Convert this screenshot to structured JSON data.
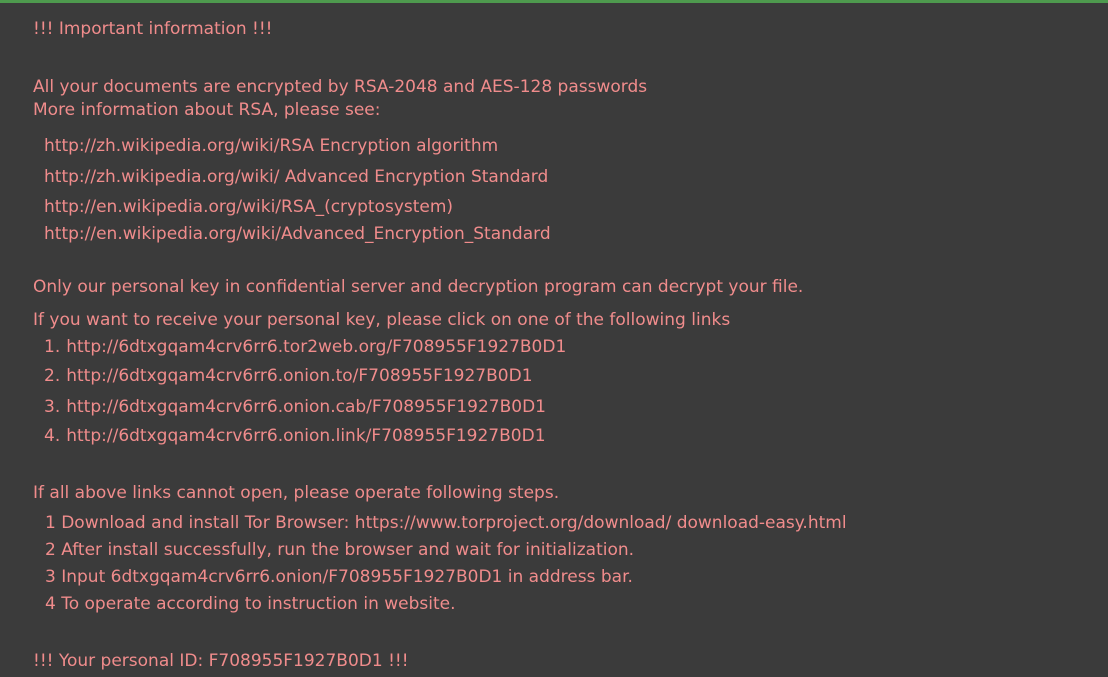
{
  "colors": {
    "background": "#3b3b3b",
    "text": "#f08c8c",
    "top_accent": "#4e9a4e"
  },
  "note": {
    "header": "!!! Important information !!!",
    "intro_line1": "All your documents are encrypted by RSA-2048 and AES-128 passwords",
    "intro_line2": "More information about RSA, please see:",
    "reference_links": [
      "http://zh.wikipedia.org/wiki/RSA  Encryption algorithm",
      "http://zh.wikipedia.org/wiki/  Advanced Encryption Standard",
      "http://en.wikipedia.org/wiki/RSA_(cryptosystem)",
      "http://en.wikipedia.org/wiki/Advanced_Encryption_Standard"
    ],
    "key_line1": "Only our personal key in confidential server and decryption program can decrypt your file.",
    "key_line2": "If you want to receive your personal key, please click on one of the following links",
    "payment_links": [
      {
        "num": "1.",
        "url": "http://6dtxgqam4crv6rr6.tor2web.org/F708955F1927B0D1"
      },
      {
        "num": "2.",
        "url": "http://6dtxgqam4crv6rr6.onion.to/F708955F1927B0D1"
      },
      {
        "num": "3.",
        "url": "http://6dtxgqam4crv6rr6.onion.cab/F708955F1927B0D1"
      },
      {
        "num": "4.",
        "url": "http://6dtxgqam4crv6rr6.onion.link/F708955F1927B0D1"
      }
    ],
    "fallback_intro": "If all above links cannot open, please operate following steps.",
    "steps": [
      "1 Download and install Tor Browser: https://www.torproject.org/download/ download-easy.html",
      "2 After install successfully, run the browser and wait for initialization.",
      "3 Input 6dtxgqam4crv6rr6.onion/F708955F1927B0D1 in address bar.",
      "4 To operate according to instruction in website."
    ],
    "personal_id": "!!! Your personal ID: F708955F1927B0D1 !!!"
  }
}
